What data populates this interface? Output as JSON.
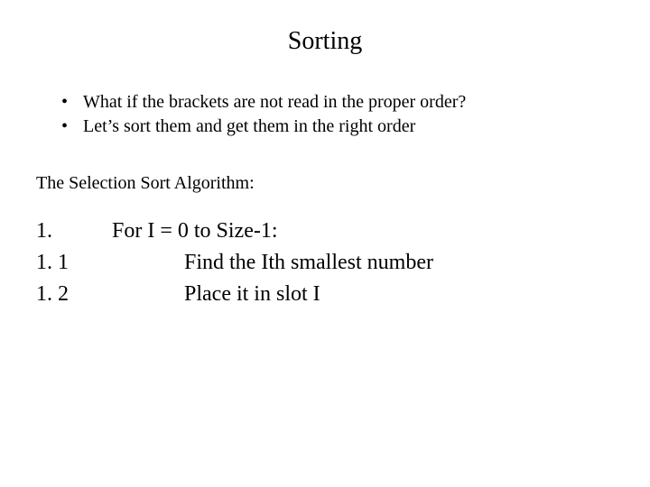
{
  "title": "Sorting",
  "bullets": [
    "What if the brackets are not read in the proper order?",
    "Let’s sort them and get them in the right order"
  ],
  "subheading": "The Selection Sort Algorithm:",
  "algorithm": [
    {
      "num": "1.",
      "text": "For I = 0 to Size-1:",
      "indent": 1
    },
    {
      "num": "1. 1",
      "text": "Find the Ith smallest number",
      "indent": 2
    },
    {
      "num": "1. 2",
      "text": "Place it in slot I",
      "indent": 2
    }
  ]
}
